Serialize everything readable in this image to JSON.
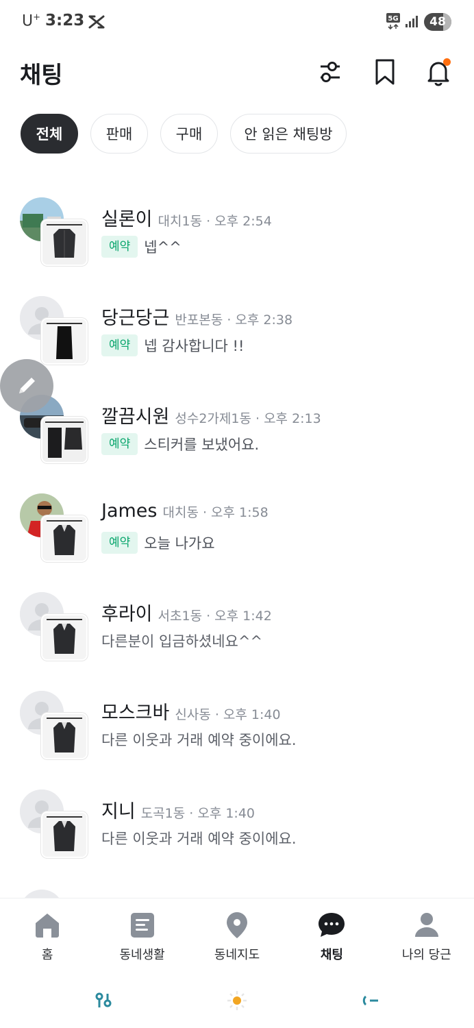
{
  "status_bar": {
    "carrier": "U",
    "carrier_sup": "+",
    "time": "3:23",
    "network": "5G",
    "battery": "48"
  },
  "header": {
    "title": "채팅",
    "filter_icon": "sliders-icon",
    "bookmark_icon": "bookmark-icon",
    "notification_icon": "bell-icon"
  },
  "filters": [
    {
      "label": "전체",
      "active": true
    },
    {
      "label": "판매",
      "active": false
    },
    {
      "label": "구매",
      "active": false
    },
    {
      "label": "안 읽은 채팅방",
      "active": false
    }
  ],
  "chats": [
    {
      "name": "실론이",
      "meta": "대치1동 · 오후 2:54",
      "tag": "예약",
      "message": "넵^^"
    },
    {
      "name": "당근당근",
      "meta": "반포본동 · 오후 2:38",
      "tag": "예약",
      "message": "넵 감사합니다 !!"
    },
    {
      "name": "깔끔시원",
      "meta": "성수2가제1동 · 오후 2:13",
      "tag": "예약",
      "message": "스티커를 보냈어요."
    },
    {
      "name": "James",
      "meta": "대치동 · 오후 1:58",
      "tag": "예약",
      "message": "오늘 나가요"
    },
    {
      "name": "후라이",
      "meta": "서초1동 · 오후 1:42",
      "tag": "",
      "message": "다른분이 입금하셨네요^^"
    },
    {
      "name": "모스크바",
      "meta": "신사동 · 오후 1:40",
      "tag": "",
      "message": "다른 이웃과 거래 예약 중이에요."
    },
    {
      "name": "지니",
      "meta": "도곡1동 · 오후 1:40",
      "tag": "",
      "message": "다른 이웃과 거래 예약 중이에요."
    }
  ],
  "bottom_nav": [
    {
      "label": "홈",
      "icon": "home-icon"
    },
    {
      "label": "동네생활",
      "icon": "community-icon"
    },
    {
      "label": "동네지도",
      "icon": "map-pin-icon"
    },
    {
      "label": "채팅",
      "icon": "chat-bubble-icon",
      "active": true
    },
    {
      "label": "나의 당근",
      "icon": "profile-icon"
    }
  ],
  "colors": {
    "accent": "#ff6f0f",
    "tag_bg": "#e3f6ef",
    "tag_text": "#0aa66d",
    "chip_active": "#2a2c30"
  }
}
